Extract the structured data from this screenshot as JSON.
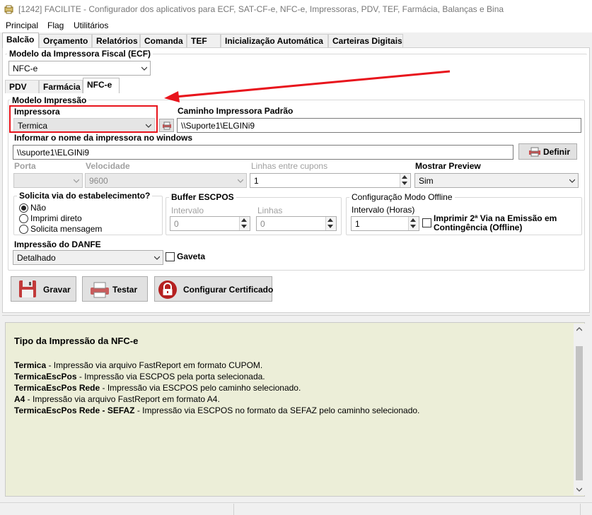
{
  "window": {
    "title": "[1242] FACILITE - Configurador dos aplicativos para ECF, SAT-CF-e, NFC-e, Impressoras, PDV, TEF, Farmácia, Balanças e Bina"
  },
  "menu": [
    "Principal",
    "Flag",
    "Utilitários"
  ],
  "tabs": [
    "Balcão",
    "Orçamento",
    "Relatórios",
    "Comanda",
    "TEF",
    "Inicialização Automática",
    "Carteiras Digitais"
  ],
  "model_group": {
    "title": "Modelo da Impressora Fiscal (ECF)",
    "value": "NFC-e"
  },
  "subtabs": [
    "PDV",
    "Farmácia",
    "NFC-e"
  ],
  "print_model": {
    "title": "Modelo Impressão",
    "impressora_label": "Impressora",
    "impressora_value": "Termica",
    "caminho_label": "Caminho Impressora Padrão",
    "caminho_value": "\\\\Suporte1\\ELGINi9",
    "windows_label": "Informar o nome da impressora no windows",
    "windows_value": "\\\\suporte1\\ELGINi9",
    "definir_label": "Definir",
    "porta_label": "Porta",
    "porta_value": "",
    "velocidade_label": "Velocidade",
    "velocidade_value": "9600",
    "linhas_label": "Linhas entre cupons",
    "linhas_value": "1",
    "preview_label": "Mostrar Preview",
    "preview_value": "Sim"
  },
  "via_group": {
    "title": "Solicita via do estabelecimento?",
    "options": [
      "Não",
      "Imprimi direto",
      "Solicita mensagem"
    ],
    "selected": "Não"
  },
  "buffer_group": {
    "title": "Buffer ESCPOS",
    "intervalo_label": "Intervalo",
    "intervalo_value": "0",
    "linhas_label": "Linhas",
    "linhas_value": "0"
  },
  "offline_group": {
    "title": "Configuração Modo Offline",
    "intervalo_label": "Intervalo (Horas)",
    "intervalo_value": "1",
    "checkbox_label_1": "Imprimir 2ª Via na Emissão em",
    "checkbox_label_2": "Contingência (Offline)"
  },
  "danfe": {
    "label": "Impressão do DANFE",
    "value": "Detalhado",
    "gaveta_label": "Gaveta"
  },
  "buttons": {
    "gravar": "Gravar",
    "testar": "Testar",
    "certificado": "Configurar Certificado"
  },
  "help": {
    "heading": "Tipo da Impressão da NFC-e",
    "items": [
      {
        "term": "Termica",
        "desc": " - Impressão via arquivo FastReport em formato CUPOM."
      },
      {
        "term": "TermicaEscPos",
        "desc": " - Impressão via ESCPOS pela porta selecionada."
      },
      {
        "term": "TermicaEscPos Rede",
        "desc": " - Impressão via ESCPOS pelo caminho selecionado."
      },
      {
        "term": "A4",
        "desc": " - Impressão via arquivo FastReport em formato A4."
      },
      {
        "term": "TermicaEscPos Rede - SEFAZ",
        "desc": " - Impressão via ESCPOS no formato da SEFAZ pelo caminho selecionado."
      }
    ]
  },
  "colors": {
    "annotation": "#e8141c",
    "help_bg": "#eceed8",
    "panel_bg": "#ffffff"
  }
}
